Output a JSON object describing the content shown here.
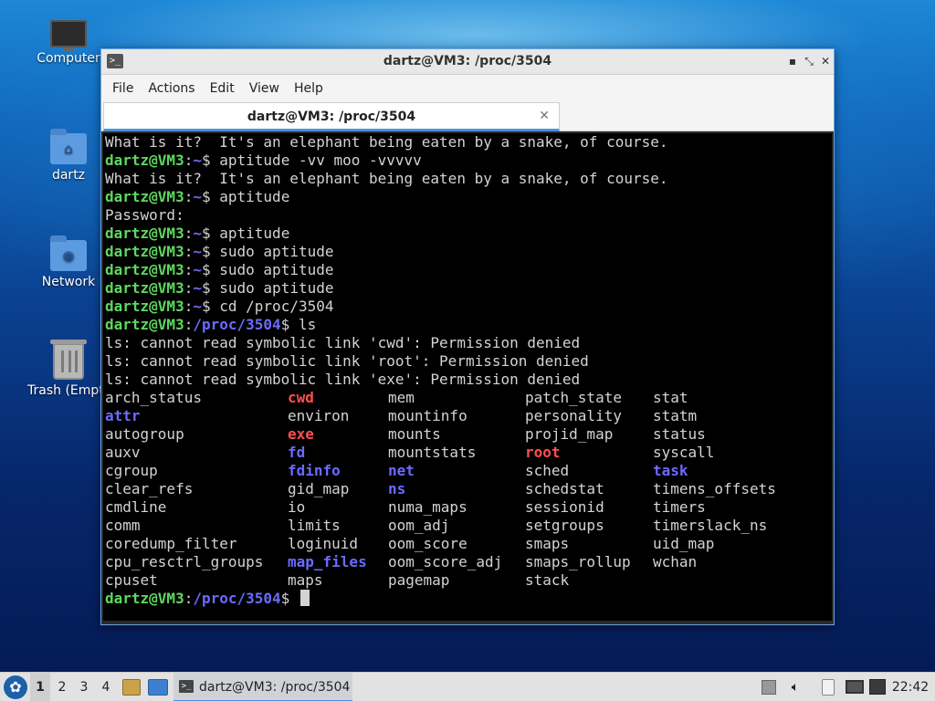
{
  "desktop": {
    "icons": [
      {
        "label": "Computer",
        "icon": "computer-icon"
      },
      {
        "label": "dartz",
        "icon": "home-folder-icon"
      },
      {
        "label": "Network",
        "icon": "network-folder-icon"
      },
      {
        "label": "Trash (Empty)",
        "icon": "trash-icon"
      }
    ]
  },
  "window": {
    "title": "dartz@VM3: /proc/3504",
    "controls": {
      "minimize": "▪",
      "maximize": "⤡",
      "close": "✕"
    },
    "menu": [
      "File",
      "Actions",
      "Edit",
      "View",
      "Help"
    ],
    "tab": {
      "label": "dartz@VM3: /proc/3504",
      "close": "✕"
    }
  },
  "terminal": {
    "lines": [
      {
        "text": "What is it?  It's an elephant being eaten by a snake, of course."
      },
      {
        "user": "dartz@VM3",
        "path": "~",
        "cmd": " aptitude -vv moo -vvvvv"
      },
      {
        "text": "What is it?  It's an elephant being eaten by a snake, of course."
      },
      {
        "user": "dartz@VM3",
        "path": "~",
        "cmd": " aptitude"
      },
      {
        "text": "Password:"
      },
      {
        "user": "dartz@VM3",
        "path": "~",
        "cmd": " aptitude"
      },
      {
        "user": "dartz@VM3",
        "path": "~",
        "cmd": " sudo aptitude"
      },
      {
        "user": "dartz@VM3",
        "path": "~",
        "cmd": " sudo aptitude"
      },
      {
        "user": "dartz@VM3",
        "path": "~",
        "cmd": " sudo aptitude"
      },
      {
        "user": "dartz@VM3",
        "path": "~",
        "cmd": " cd /proc/3504"
      },
      {
        "user": "dartz@VM3",
        "path": "/proc/3504",
        "cmd": " ls"
      },
      {
        "text": "ls: cannot read symbolic link 'cwd': Permission denied"
      },
      {
        "text": "ls: cannot read symbolic link 'root': Permission denied"
      },
      {
        "text": "ls: cannot read symbolic link 'exe': Permission denied"
      }
    ],
    "ls_rows": [
      [
        {
          "t": "arch_status",
          "k": "f"
        },
        {
          "t": "cwd",
          "k": "l"
        },
        {
          "t": "mem",
          "k": "f"
        },
        {
          "t": "patch_state",
          "k": "f"
        },
        {
          "t": "stat",
          "k": "f"
        }
      ],
      [
        {
          "t": "attr",
          "k": "d"
        },
        {
          "t": "environ",
          "k": "f"
        },
        {
          "t": "mountinfo",
          "k": "f"
        },
        {
          "t": "personality",
          "k": "f"
        },
        {
          "t": "statm",
          "k": "f"
        }
      ],
      [
        {
          "t": "autogroup",
          "k": "f"
        },
        {
          "t": "exe",
          "k": "l"
        },
        {
          "t": "mounts",
          "k": "f"
        },
        {
          "t": "projid_map",
          "k": "f"
        },
        {
          "t": "status",
          "k": "f"
        }
      ],
      [
        {
          "t": "auxv",
          "k": "f"
        },
        {
          "t": "fd",
          "k": "d"
        },
        {
          "t": "mountstats",
          "k": "f"
        },
        {
          "t": "root",
          "k": "l"
        },
        {
          "t": "syscall",
          "k": "f"
        }
      ],
      [
        {
          "t": "cgroup",
          "k": "f"
        },
        {
          "t": "fdinfo",
          "k": "d"
        },
        {
          "t": "net",
          "k": "d"
        },
        {
          "t": "sched",
          "k": "f"
        },
        {
          "t": "task",
          "k": "d"
        }
      ],
      [
        {
          "t": "clear_refs",
          "k": "f"
        },
        {
          "t": "gid_map",
          "k": "f"
        },
        {
          "t": "ns",
          "k": "d"
        },
        {
          "t": "schedstat",
          "k": "f"
        },
        {
          "t": "timens_offsets",
          "k": "f"
        }
      ],
      [
        {
          "t": "cmdline",
          "k": "f"
        },
        {
          "t": "io",
          "k": "f"
        },
        {
          "t": "numa_maps",
          "k": "f"
        },
        {
          "t": "sessionid",
          "k": "f"
        },
        {
          "t": "timers",
          "k": "f"
        }
      ],
      [
        {
          "t": "comm",
          "k": "f"
        },
        {
          "t": "limits",
          "k": "f"
        },
        {
          "t": "oom_adj",
          "k": "f"
        },
        {
          "t": "setgroups",
          "k": "f"
        },
        {
          "t": "timerslack_ns",
          "k": "f"
        }
      ],
      [
        {
          "t": "coredump_filter",
          "k": "f"
        },
        {
          "t": "loginuid",
          "k": "f"
        },
        {
          "t": "oom_score",
          "k": "f"
        },
        {
          "t": "smaps",
          "k": "f"
        },
        {
          "t": "uid_map",
          "k": "f"
        }
      ],
      [
        {
          "t": "cpu_resctrl_groups",
          "k": "f"
        },
        {
          "t": "map_files",
          "k": "d"
        },
        {
          "t": "oom_score_adj",
          "k": "f"
        },
        {
          "t": "smaps_rollup",
          "k": "f"
        },
        {
          "t": "wchan",
          "k": "f"
        }
      ],
      [
        {
          "t": "cpuset",
          "k": "f"
        },
        {
          "t": "maps",
          "k": "f"
        },
        {
          "t": "pagemap",
          "k": "f"
        },
        {
          "t": "stack",
          "k": "f"
        },
        {
          "t": "",
          "k": "f"
        }
      ]
    ],
    "final_prompt": {
      "user": "dartz@VM3",
      "path": "/proc/3504",
      "cmd": " "
    },
    "colors": {
      "user": "#5fd75f",
      "path": "#6b6bff",
      "dir": "#6b6bff",
      "symlink": "#ff4f4f",
      "text": "#d3d3d3"
    }
  },
  "taskbar": {
    "workspaces": [
      "1",
      "2",
      "3",
      "4"
    ],
    "active_workspace": "1",
    "task_label": "dartz@VM3: /proc/3504",
    "tray_icons": [
      "notes-icon",
      "volume-icon",
      "clipboard-icon",
      "display-icon",
      "network-icon"
    ],
    "clock": "22:42"
  }
}
